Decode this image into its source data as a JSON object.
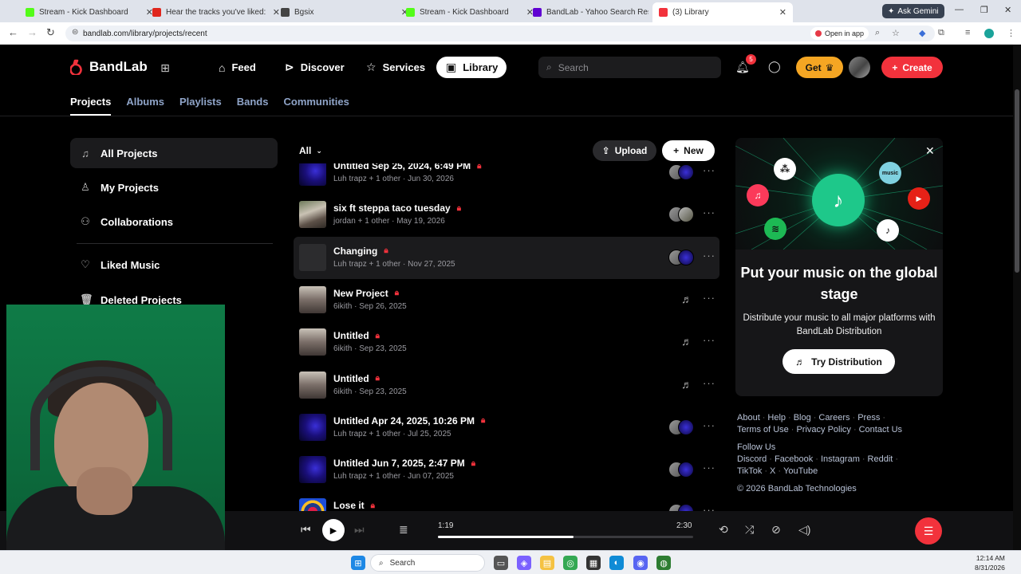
{
  "browser": {
    "tabs": [
      {
        "label": "Stream - Kick Dashboard",
        "color": "#53fc18"
      },
      {
        "label": "Hear the tracks you've liked: on",
        "color": "#e0261d"
      },
      {
        "label": "Bgsix",
        "color": "#444444"
      },
      {
        "label": "Stream - Kick Dashboard",
        "color": "#53fc18"
      },
      {
        "label": "BandLab - Yahoo Search Result",
        "color": "#6001d2"
      },
      {
        "label": "(3) Library",
        "color": "#f2323c"
      }
    ],
    "ask_gemini": "Ask Gemini",
    "url": "bandlab.com/library/projects/recent",
    "open_in_app": "Open in app"
  },
  "header": {
    "logo": "BandLab",
    "nav": [
      {
        "label": "Feed",
        "icon": "home-icon"
      },
      {
        "label": "Discover",
        "icon": "play-circle-icon"
      },
      {
        "label": "Services",
        "icon": "star-icon"
      },
      {
        "label": "Library",
        "icon": "library-icon"
      }
    ],
    "search_placeholder": "Search",
    "notifications_count": "5",
    "get_label": "Get",
    "create_label": "Create"
  },
  "subtabs": [
    "Projects",
    "Albums",
    "Playlists",
    "Bands",
    "Communities"
  ],
  "sidebar": {
    "items": [
      {
        "label": "All Projects",
        "icon": "note-icon"
      },
      {
        "label": "My Projects",
        "icon": "person-icon"
      },
      {
        "label": "Collaborations",
        "icon": "people-icon"
      },
      {
        "label": "Liked Music",
        "icon": "heart-icon"
      },
      {
        "label": "Deleted Projects",
        "icon": "trash-icon"
      }
    ]
  },
  "list": {
    "filter": "All",
    "upload_label": "Upload",
    "new_label": "New",
    "projects": [
      {
        "title": "Untitled Sep 25, 2024, 6:49 PM",
        "author": "Luh trapz + 1 other",
        "date": "Jun 30, 2026",
        "thumb": "purple",
        "collab": true
      },
      {
        "title": "six ft steppa taco tuesday",
        "author": "jordan + 1 other",
        "date": "May 19, 2026",
        "thumb": "photo",
        "collab": true
      },
      {
        "title": "Changing",
        "author": "Luh trapz + 1 other",
        "date": "Nov 27, 2025",
        "thumb": "dark",
        "collab": true
      },
      {
        "title": "New Project",
        "author": "6ikith",
        "date": "Sep 26, 2025",
        "thumb": "room",
        "collab": false
      },
      {
        "title": "Untitled",
        "author": "6ikith",
        "date": "Sep 23, 2025",
        "thumb": "room",
        "collab": false
      },
      {
        "title": "Untitled",
        "author": "6ikith",
        "date": "Sep 23, 2025",
        "thumb": "room",
        "collab": false
      },
      {
        "title": "Untitled Apr 24, 2025, 10:26 PM",
        "author": "Luh trapz + 1 other",
        "date": "Jul 25, 2025",
        "thumb": "purple",
        "collab": true
      },
      {
        "title": "Untitled Jun 7, 2025, 2:47 PM",
        "author": "Luh trapz + 1 other",
        "date": "Jun 07, 2025",
        "thumb": "purple",
        "collab": true
      },
      {
        "title": "Lose it",
        "author": "",
        "date": "",
        "thumb": "target",
        "collab": true
      }
    ]
  },
  "promo": {
    "title": "Put your music on the global stage",
    "description": "Distribute your music to all major platforms with BandLab Distribution",
    "button": "Try Distribution"
  },
  "footer": {
    "links1": [
      "About",
      "Help",
      "Blog",
      "Careers",
      "Press"
    ],
    "links2": [
      "Terms of Use",
      "Privacy Policy",
      "Contact Us"
    ],
    "follow": "Follow Us",
    "social1": [
      "Discord",
      "Facebook",
      "Instagram",
      "Reddit"
    ],
    "social2": [
      "TikTok",
      "X",
      "YouTube"
    ],
    "copyright": "© 2026 BandLab Technologies"
  },
  "player": {
    "current_time": "1:19",
    "total_time": "2:30",
    "progress": 0.53
  },
  "taskbar": {
    "search": "Search",
    "time": "12:14 AM",
    "date": "8/31/2026"
  }
}
